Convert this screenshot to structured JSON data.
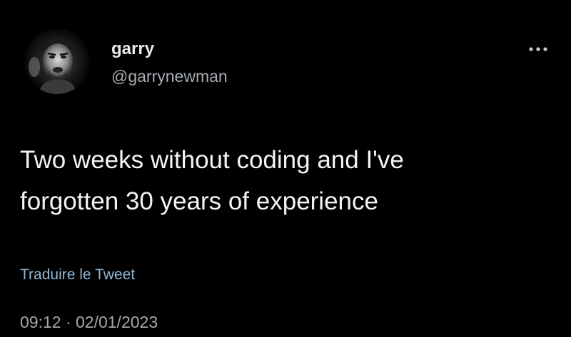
{
  "tweet": {
    "display_name": "garry",
    "handle": "@garrynewman",
    "text": "Two weeks without coding and I've\nforgotten 30 years of experience",
    "translate_label": "Traduire le Tweet",
    "timestamp": "09:12 · 02/01/2023",
    "more_icon": "ellipsis-icon"
  },
  "colors": {
    "background": "#000000",
    "primary_text": "#e7e9ea",
    "secondary_text": "#a6acb2",
    "link": "#8fb8d6"
  }
}
